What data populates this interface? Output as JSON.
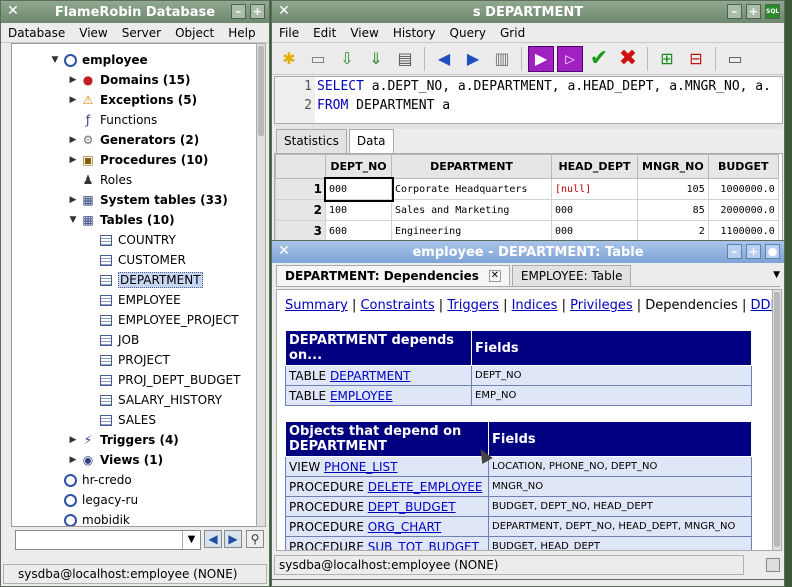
{
  "left": {
    "title": "FlameRobin Database",
    "menu": [
      "Database",
      "View",
      "Server",
      "Object",
      "Help"
    ],
    "tree": [
      {
        "label": "employee",
        "bold": true,
        "indent": 0,
        "arrow": "▼",
        "icon": "database-icon"
      },
      {
        "label": "Domains (15)",
        "bold": true,
        "indent": 1,
        "arrow": "▶",
        "icon": "domains-icon"
      },
      {
        "label": "Exceptions (5)",
        "bold": true,
        "indent": 1,
        "arrow": "▶",
        "icon": "exception-icon"
      },
      {
        "label": "Functions",
        "bold": false,
        "indent": 1,
        "arrow": "",
        "icon": "functions-icon"
      },
      {
        "label": "Generators (2)",
        "bold": true,
        "indent": 1,
        "arrow": "▶",
        "icon": "generators-icon"
      },
      {
        "label": "Procedures (10)",
        "bold": true,
        "indent": 1,
        "arrow": "▶",
        "icon": "procedures-icon"
      },
      {
        "label": "Roles",
        "bold": false,
        "indent": 1,
        "arrow": "",
        "icon": "roles-icon"
      },
      {
        "label": "System tables (33)",
        "bold": true,
        "indent": 1,
        "arrow": "▶",
        "icon": "system-tables-icon"
      },
      {
        "label": "Tables (10)",
        "bold": true,
        "indent": 1,
        "arrow": "▼",
        "icon": "tables-icon"
      },
      {
        "label": "COUNTRY",
        "bold": false,
        "indent": 2,
        "arrow": "",
        "icon": "table-icon"
      },
      {
        "label": "CUSTOMER",
        "bold": false,
        "indent": 2,
        "arrow": "",
        "icon": "table-icon"
      },
      {
        "label": "DEPARTMENT",
        "bold": false,
        "indent": 2,
        "arrow": "",
        "icon": "table-icon",
        "selected": true
      },
      {
        "label": "EMPLOYEE",
        "bold": false,
        "indent": 2,
        "arrow": "",
        "icon": "table-icon"
      },
      {
        "label": "EMPLOYEE_PROJECT",
        "bold": false,
        "indent": 2,
        "arrow": "",
        "icon": "table-icon"
      },
      {
        "label": "JOB",
        "bold": false,
        "indent": 2,
        "arrow": "",
        "icon": "table-icon"
      },
      {
        "label": "PROJECT",
        "bold": false,
        "indent": 2,
        "arrow": "",
        "icon": "table-icon"
      },
      {
        "label": "PROJ_DEPT_BUDGET",
        "bold": false,
        "indent": 2,
        "arrow": "",
        "icon": "table-icon"
      },
      {
        "label": "SALARY_HISTORY",
        "bold": false,
        "indent": 2,
        "arrow": "",
        "icon": "table-icon"
      },
      {
        "label": "SALES",
        "bold": false,
        "indent": 2,
        "arrow": "",
        "icon": "table-icon"
      },
      {
        "label": "Triggers (4)",
        "bold": true,
        "indent": 1,
        "arrow": "▶",
        "icon": "triggers-icon"
      },
      {
        "label": "Views (1)",
        "bold": true,
        "indent": 1,
        "arrow": "▶",
        "icon": "views-icon"
      },
      {
        "label": "hr-credo",
        "bold": false,
        "indent": 0,
        "arrow": "",
        "icon": "database-icon"
      },
      {
        "label": "legacy-ru",
        "bold": false,
        "indent": 0,
        "arrow": "",
        "icon": "database-icon"
      },
      {
        "label": "mobidik",
        "bold": false,
        "indent": 0,
        "arrow": "",
        "icon": "database-icon"
      }
    ],
    "status": "sysdba@localhost:employee (NONE)"
  },
  "right": {
    "title": "s DEPARTMENT",
    "menu": [
      "File",
      "Edit",
      "View",
      "History",
      "Query",
      "Grid"
    ],
    "sql_lines": [
      {
        "n": "1",
        "kw": "SELECT",
        "rest": " a.DEPT_NO, a.DEPARTMENT, a.HEAD_DEPT, a.MNGR_NO, a."
      },
      {
        "n": "2",
        "kw": "FROM",
        "rest": " DEPARTMENT a"
      }
    ],
    "tabs": [
      "Statistics",
      "Data"
    ],
    "grid": {
      "headers": [
        "",
        "DEPT_NO",
        "DEPARTMENT",
        "HEAD_DEPT",
        "MNGR_NO",
        "BUDGET"
      ],
      "rows": [
        [
          "1",
          "000",
          "Corporate Headquarters",
          "[null]",
          "105",
          "1000000.0"
        ],
        [
          "2",
          "100",
          "Sales and Marketing",
          "000",
          "85",
          "2000000.0"
        ],
        [
          "3",
          "600",
          "Engineering",
          "000",
          "2",
          "1100000.0"
        ]
      ]
    }
  },
  "props": {
    "title": "employee - DEPARTMENT: Table",
    "tab_active": "DEPARTMENT: Dependencies",
    "tab_other": "EMPLOYEE: Table",
    "links": [
      "Summary",
      "Constraints",
      "Triggers",
      "Indices",
      "Privileges"
    ],
    "current": "Dependencies",
    "ddl": "DDL",
    "t1": {
      "h1": "DEPARTMENT depends on...",
      "h2": "Fields",
      "rows": [
        {
          "type": "TABLE",
          "name": "DEPARTMENT",
          "fields": "DEPT_NO"
        },
        {
          "type": "TABLE",
          "name": "EMPLOYEE",
          "fields": "EMP_NO"
        }
      ]
    },
    "t2": {
      "h1": "Objects that depend on DEPARTMENT",
      "h2": "Fields",
      "rows": [
        {
          "type": "VIEW",
          "name": "PHONE_LIST",
          "fields": "LOCATION, PHONE_NO, DEPT_NO"
        },
        {
          "type": "PROCEDURE",
          "name": "DELETE_EMPLOYEE",
          "fields": "MNGR_NO"
        },
        {
          "type": "PROCEDURE",
          "name": "DEPT_BUDGET",
          "fields": "BUDGET, DEPT_NO, HEAD_DEPT"
        },
        {
          "type": "PROCEDURE",
          "name": "ORG_CHART",
          "fields": "DEPARTMENT, DEPT_NO, HEAD_DEPT, MNGR_NO"
        },
        {
          "type": "PROCEDURE",
          "name": "SUB_TOT_BUDGET",
          "fields": "BUDGET, HEAD_DEPT"
        }
      ]
    },
    "status": "sysdba@localhost:employee (NONE)"
  }
}
